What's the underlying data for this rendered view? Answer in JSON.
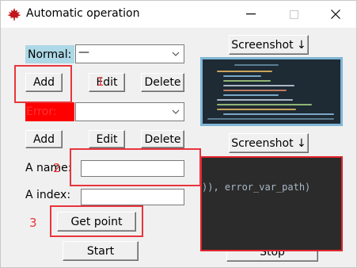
{
  "window": {
    "title": "Automatic operation",
    "controls": {
      "minimize": "—",
      "close": "✕"
    }
  },
  "normal": {
    "label": "Normal:",
    "combo_value": "—",
    "add_label": "Add",
    "edit_label": "Edit",
    "delete_label": "Delete"
  },
  "error": {
    "label": "Error:",
    "combo_value": "",
    "add_label": "Add",
    "edit_label": "Edit",
    "delete_label": "Delete"
  },
  "screenshot": {
    "top_label": "Screenshot ↓",
    "bottom_label": "Screenshot ↓"
  },
  "fields": {
    "name_label": "A name:",
    "name_value": "",
    "index_label": "A index:",
    "index_value": ""
  },
  "actions": {
    "get_point_label": "Get point",
    "start_label": "Start",
    "stop_label": "Stop"
  },
  "preview": {
    "code_text": ")), error_var_path)"
  },
  "annotations": {
    "n1": "1",
    "n2": "2",
    "n3": "3"
  },
  "colors": {
    "normal_label_bg": "#add8e6",
    "error_label_bg": "#ff0000",
    "annotation": "#e8353c",
    "preview_border": "#7fb6d6",
    "dark_panel_border": "#e0242c"
  },
  "icons": {
    "app": "maple-leaf-icon",
    "combo_arrow": "chevron-down-icon"
  }
}
